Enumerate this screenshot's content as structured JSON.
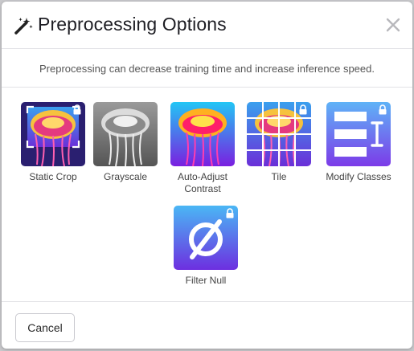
{
  "dialog": {
    "title": "Preprocessing Options",
    "title_icon": "magic-wand-icon",
    "close_icon": "close-icon",
    "subtitle": "Preprocessing can decrease training time and increase inference speed."
  },
  "options": [
    {
      "label": "Static Crop",
      "icon": "crop-icon",
      "locked": true
    },
    {
      "label": "Grayscale",
      "icon": "grayscale-icon",
      "locked": false
    },
    {
      "label": "Auto-Adjust Contrast",
      "icon": "contrast-icon",
      "locked": false
    },
    {
      "label": "Tile",
      "icon": "tile-grid-icon",
      "locked": true
    },
    {
      "label": "Modify Classes",
      "icon": "modify-classes-icon",
      "locked": true
    },
    {
      "label": "Filter Null",
      "icon": "null-symbol-icon",
      "locked": true
    }
  ],
  "footer": {
    "cancel_label": "Cancel"
  },
  "colors": {
    "accent_purple": "#7b2fe0",
    "accent_blue": "#5aa8f5",
    "lock": "#ffffff"
  }
}
